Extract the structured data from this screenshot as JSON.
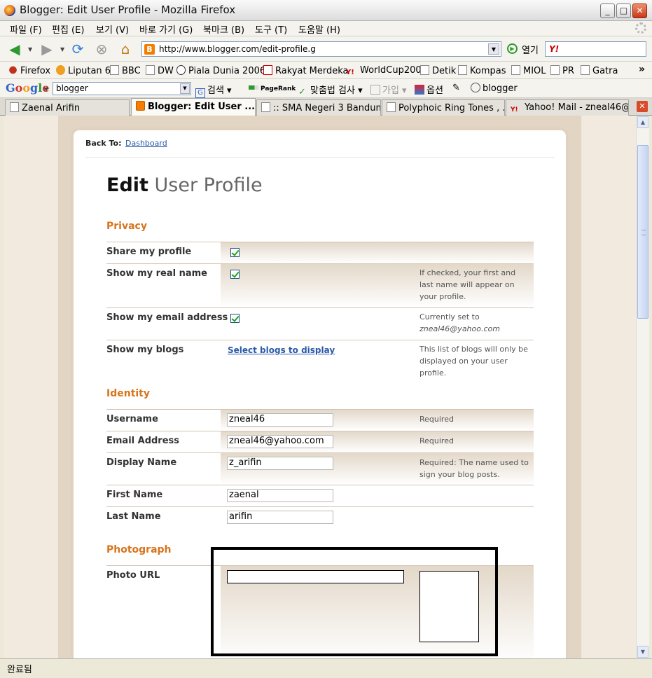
{
  "window": {
    "title": "Blogger: Edit User Profile - Mozilla Firefox"
  },
  "menu": [
    "파일 (F)",
    "편집 (E)",
    "보기 (V)",
    "바로 가기 (G)",
    "북마크 (B)",
    "도구 (T)",
    "도움말 (H)"
  ],
  "nav": {
    "url": "http://www.blogger.com/edit-profile.g",
    "go_label": "열기",
    "search_icon": "Y!"
  },
  "bookmarks": [
    "Firefox",
    "Liputan 6",
    "BBC",
    "DW",
    "Piala Dunia 2006",
    "Rakyat Merdeka",
    "WorldCup2006",
    "Detik",
    "Kompas",
    "MIOL",
    "PR",
    "Gatra"
  ],
  "google_bar": {
    "logo": "Google",
    "query": "blogger",
    "search_label": "검색",
    "pagerank_label": "PageRank",
    "spell_label": "맞춤법 검사",
    "signup_label": "가입",
    "options_label": "옵션",
    "highlight_label": "blogger"
  },
  "tabs": [
    {
      "label": "Zaenal Arifin",
      "active": false
    },
    {
      "label": "Blogger: Edit User ...",
      "active": true
    },
    {
      "label": ":: SMA Negeri 3 Bandun...",
      "active": false
    },
    {
      "label": "Polyphoic Ring Tones , ...",
      "active": false
    },
    {
      "label": "Yahoo! Mail - zneal46@...",
      "active": false
    }
  ],
  "page": {
    "back_to_label": "Back To:",
    "back_to_link": "Dashboard",
    "title_bold": "Edit",
    "title_rest": " User Profile",
    "privacy": {
      "heading": "Privacy",
      "share_profile": "Share my profile",
      "show_real_name": "Show my real name",
      "show_real_name_note": "If checked, your first and last name will appear on your profile.",
      "show_email": "Show my email address",
      "show_email_note": "Currently set to",
      "show_email_value": "zneal46@yahoo.com",
      "show_blogs": "Show my blogs",
      "show_blogs_link": "Select blogs to display",
      "show_blogs_note": "This list of blogs will only be displayed on your user profile."
    },
    "identity": {
      "heading": "Identity",
      "username_label": "Username",
      "username_value": "zneal46",
      "username_note": "Required",
      "email_label": "Email Address",
      "email_value": "zneal46@yahoo.com",
      "email_note": "Required",
      "display_label": "Display Name",
      "display_value": "z_arifin",
      "display_note": "Required: The name used to sign your blog posts.",
      "first_label": "First Name",
      "first_value": "zaenal",
      "last_label": "Last Name",
      "last_value": "arifin"
    },
    "photograph": {
      "heading": "Photograph",
      "photo_label": "Photo URL"
    }
  },
  "status": "완료됨"
}
